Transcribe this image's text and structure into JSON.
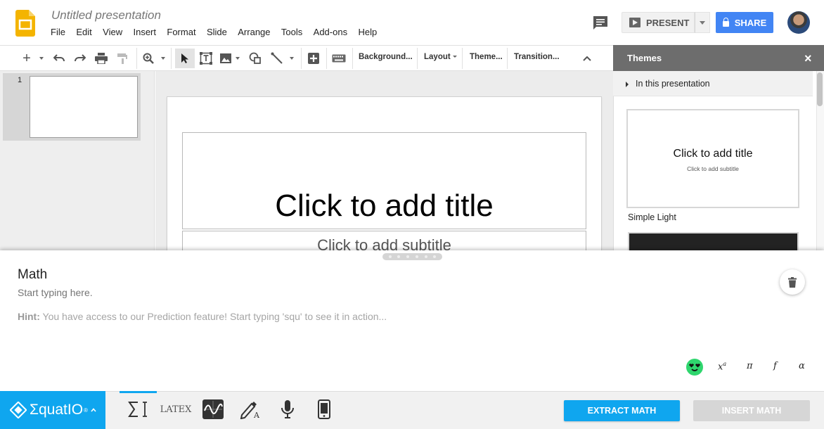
{
  "app": {
    "doc_title": "Untitled presentation",
    "menu": [
      "File",
      "Edit",
      "View",
      "Insert",
      "Format",
      "Slide",
      "Arrange",
      "Tools",
      "Add-ons",
      "Help"
    ],
    "present_label": "PRESENT",
    "share_label": "SHARE",
    "colors": {
      "brand_yellow": "#f4b400",
      "share_blue": "#4285f4",
      "equatio_blue": "#0fa6ef"
    }
  },
  "toolbar": {
    "background_label": "Background...",
    "layout_label": "Layout",
    "theme_label": "Theme...",
    "transition_label": "Transition..."
  },
  "filmstrip": {
    "slide_number": "1"
  },
  "slide": {
    "title_placeholder": "Click to add title",
    "subtitle_placeholder": "Click to add subtitle"
  },
  "themes_panel": {
    "title": "Themes",
    "close_icon": "×",
    "section_label": "In this presentation",
    "theme_preview_title": "Click to add title",
    "theme_preview_subtitle": "Click to add subtitle",
    "theme_name": "Simple Light"
  },
  "math_panel": {
    "heading": "Math",
    "input_placeholder": "Start typing here.",
    "hint_prefix": "Hint:",
    "hint_text": " You have access to our Prediction feature! Start typing 'squ' to see it in action...",
    "symbols": [
      "x",
      "a",
      "π",
      "f",
      "α"
    ]
  },
  "bottom_bar": {
    "brand": "ΣquatIO",
    "brand_mark": "®",
    "latex_label": "LATEX",
    "extract_label": "EXTRACT MATH",
    "insert_label": "INSERT MATH"
  }
}
